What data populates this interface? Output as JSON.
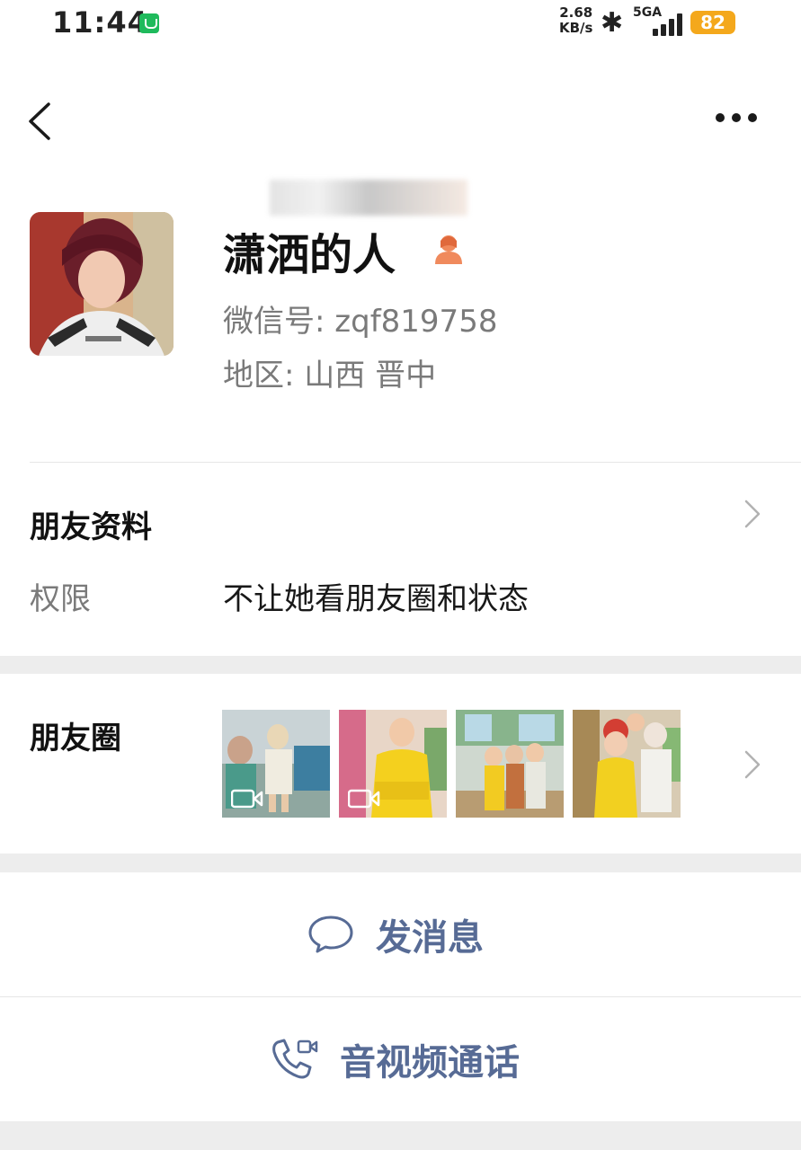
{
  "status_bar": {
    "time": "11:44",
    "speed_value": "2.68",
    "speed_unit": "KB/s",
    "network": "5GA",
    "battery": "82",
    "battery_color": "#f4a81c"
  },
  "header": {
    "back_icon": "chevron-left-icon",
    "more_icon": "more-dots-icon"
  },
  "profile": {
    "name": "潇洒的人",
    "wechat_id": "微信号: zqf819758",
    "region": "地区: 山西  晋中",
    "gender_icon": "female-icon"
  },
  "friend_info": {
    "title": "朋友资料",
    "permission_label": "权限",
    "permission_value": "不让她看朋友圈和状态"
  },
  "moments": {
    "title": "朋友圈",
    "thumbnails": [
      {
        "type": "video"
      },
      {
        "type": "video"
      },
      {
        "type": "photo"
      },
      {
        "type": "photo"
      }
    ]
  },
  "actions": {
    "message": "发消息",
    "call": "音视频通话",
    "accent_color": "#576b95"
  }
}
